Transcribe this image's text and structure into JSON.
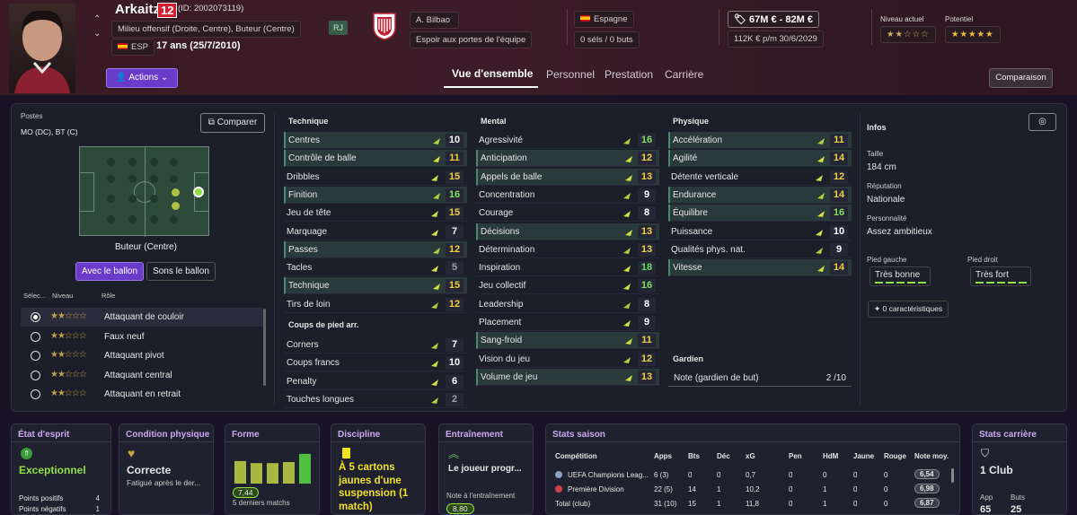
{
  "player": {
    "name": "Arkaitz",
    "number": "12",
    "id": "(ID: 2002073119)",
    "positions_long": "Milieu offensif (Droite, Centre), Buteur (Centre)",
    "foot_badge": "RJ",
    "nationality_code": "ESP",
    "age": "17 ans (25/7/2010)",
    "club": "A. Bilbao",
    "club_status": "Espoir aux portes de l'équipe",
    "country": "Espagne",
    "caps": "0 séls / 0 buts",
    "value": "67M € - 82M €",
    "wage": "112K € p/m 30/6/2029",
    "current_level_label": "Niveau actuel",
    "potential_label": "Potentiel",
    "current_stars": "★★☆☆☆",
    "potential_stars": "★★★★★"
  },
  "actions_label": "Actions",
  "tabs": [
    "Vue d'ensemble",
    "Personnel",
    "Prestation",
    "Carrière"
  ],
  "compare_top": "Comparaison",
  "positions": {
    "title": "Postes",
    "value": "MO (DC), BT (C)",
    "compare_btn": "Comparer",
    "role_name": "Buteur (Centre)",
    "with_ball": "Avec le ballon",
    "without_ball": "Sons le ballon"
  },
  "roles_header": {
    "select": "Sélec...",
    "level": "Niveau",
    "role": "Rôle"
  },
  "roles": [
    {
      "name": "Attaquant de couloir",
      "selected": true
    },
    {
      "name": "Faux neuf",
      "selected": false
    },
    {
      "name": "Attaquant pivot",
      "selected": false
    },
    {
      "name": "Attaquant central",
      "selected": false
    },
    {
      "name": "Attaquant en retrait",
      "selected": false
    }
  ],
  "technique": {
    "title": "Technique",
    "attrs": [
      {
        "name": "Centres",
        "value": "10",
        "hl": true,
        "color": "#ffffff"
      },
      {
        "name": "Contrôle de balle",
        "value": "11",
        "hl": true,
        "color": "#f0d040"
      },
      {
        "name": "Dribbles",
        "value": "15",
        "hl": false,
        "color": "#f0d040"
      },
      {
        "name": "Finition",
        "value": "16",
        "hl": true,
        "color": "#80e060"
      },
      {
        "name": "Jeu de tête",
        "value": "15",
        "hl": false,
        "color": "#f0d040"
      },
      {
        "name": "Marquage",
        "value": "7",
        "hl": false,
        "color": "#ffffff"
      },
      {
        "name": "Passes",
        "value": "12",
        "hl": true,
        "color": "#f0d040"
      },
      {
        "name": "Tacles",
        "value": "5",
        "hl": false,
        "color": "#a0a0a0"
      },
      {
        "name": "Technique",
        "value": "15",
        "hl": true,
        "color": "#f0d040"
      },
      {
        "name": "Tirs de loin",
        "value": "12",
        "hl": false,
        "color": "#f0d040"
      }
    ]
  },
  "set_pieces": {
    "title": "Coups de pied arr.",
    "attrs": [
      {
        "name": "Corners",
        "value": "7",
        "hl": false,
        "color": "#ffffff"
      },
      {
        "name": "Coups francs",
        "value": "10",
        "hl": false,
        "color": "#ffffff"
      },
      {
        "name": "Penalty",
        "value": "6",
        "hl": false,
        "color": "#ffffff"
      },
      {
        "name": "Touches longues",
        "value": "2",
        "hl": false,
        "color": "#a0a0a0"
      }
    ]
  },
  "mental": {
    "title": "Mental",
    "attrs": [
      {
        "name": "Agressivité",
        "value": "16",
        "hl": false,
        "color": "#80e060"
      },
      {
        "name": "Anticipation",
        "value": "12",
        "hl": true,
        "color": "#f0d040"
      },
      {
        "name": "Appels de balle",
        "value": "13",
        "hl": true,
        "color": "#f0d040"
      },
      {
        "name": "Concentration",
        "value": "9",
        "hl": false,
        "color": "#ffffff"
      },
      {
        "name": "Courage",
        "value": "8",
        "hl": false,
        "color": "#ffffff"
      },
      {
        "name": "Décisions",
        "value": "13",
        "hl": true,
        "color": "#f0d040"
      },
      {
        "name": "Détermination",
        "value": "13",
        "hl": false,
        "color": "#f0d040"
      },
      {
        "name": "Inspiration",
        "value": "18",
        "hl": false,
        "color": "#60e060"
      },
      {
        "name": "Jeu collectif",
        "value": "16",
        "hl": false,
        "color": "#80e060"
      },
      {
        "name": "Leadership",
        "value": "8",
        "hl": false,
        "color": "#ffffff"
      },
      {
        "name": "Placement",
        "value": "9",
        "hl": false,
        "color": "#ffffff"
      },
      {
        "name": "Sang-froid",
        "value": "11",
        "hl": true,
        "color": "#f0d040"
      },
      {
        "name": "Vision du jeu",
        "value": "12",
        "hl": false,
        "color": "#f0d040"
      },
      {
        "name": "Volume de jeu",
        "value": "13",
        "hl": true,
        "color": "#f0d040"
      }
    ]
  },
  "physical": {
    "title": "Physique",
    "attrs": [
      {
        "name": "Accélération",
        "value": "11",
        "hl": true,
        "color": "#f0d040"
      },
      {
        "name": "Agilité",
        "value": "14",
        "hl": true,
        "color": "#f0d040"
      },
      {
        "name": "Détente verticale",
        "value": "12",
        "hl": false,
        "color": "#f0d040"
      },
      {
        "name": "Endurance",
        "value": "14",
        "hl": true,
        "color": "#f0d040"
      },
      {
        "name": "Équilibre",
        "value": "16",
        "hl": true,
        "color": "#80e060"
      },
      {
        "name": "Puissance",
        "value": "10",
        "hl": false,
        "color": "#ffffff"
      },
      {
        "name": "Qualités phys. nat.",
        "value": "9",
        "hl": false,
        "color": "#ffffff"
      },
      {
        "name": "Vitesse",
        "value": "14",
        "hl": true,
        "color": "#f0d040"
      }
    ]
  },
  "goalkeeper": {
    "title": "Gardien",
    "label": "Note (gardien de but)",
    "value": "2 /10"
  },
  "info": {
    "title": "Infos",
    "height_label": "Taille",
    "height": "184 cm",
    "reputation_label": "Réputation",
    "reputation": "Nationale",
    "personality_label": "Personnalité",
    "personality": "Assez ambitieux",
    "left_foot_label": "Pied gauche",
    "left_foot": "Très bonne",
    "right_foot_label": "Pied droit",
    "right_foot": "Très fort",
    "traits": "0 caractéristiques"
  },
  "cards": {
    "morale": {
      "title": "État d'esprit",
      "value": "Exceptionnel",
      "pos_label": "Points positifs",
      "pos": "4",
      "neg_label": "Points négatifs",
      "neg": "1"
    },
    "condition": {
      "title": "Condition physique",
      "value": "Correcte",
      "detail": "Fatigué après le der..."
    },
    "form": {
      "title": "Forme",
      "avg": "7,44",
      "label": "5 derniers matchs"
    },
    "discipline": {
      "title": "Discipline",
      "text": "À 5 cartons jaunes d'une suspension (1 match)"
    },
    "training": {
      "title": "Entraînement",
      "text": "Le joueur progr...",
      "rating_label": "Note à l'entraînement",
      "rating": "8,80"
    },
    "season": {
      "title": "Stats saison",
      "headers": [
        "Compétition",
        "Apps",
        "Bts",
        "Déc",
        "xG",
        "Pen",
        "HdM",
        "Jaune",
        "Rouge",
        "Note moy."
      ],
      "rows": [
        [
          "UEFA Champions Leag...",
          "6 (3)",
          "0",
          "0",
          "0,7",
          "0",
          "0",
          "0",
          "0",
          "6,54"
        ],
        [
          "Première Division",
          "22 (5)",
          "14",
          "1",
          "10,2",
          "0",
          "1",
          "0",
          "0",
          "6,98"
        ],
        [
          "Total (club)",
          "31 (10)",
          "15",
          "1",
          "11,8",
          "0",
          "1",
          "0",
          "0",
          "6,87"
        ]
      ]
    },
    "career": {
      "title": "Stats carrière",
      "clubs": "1 Club",
      "app_label": "App",
      "app": "65",
      "goals_label": "Buts",
      "goals": "25"
    }
  },
  "form_values": [
    7.2,
    7.0,
    7.0,
    7.1,
    7.9
  ]
}
